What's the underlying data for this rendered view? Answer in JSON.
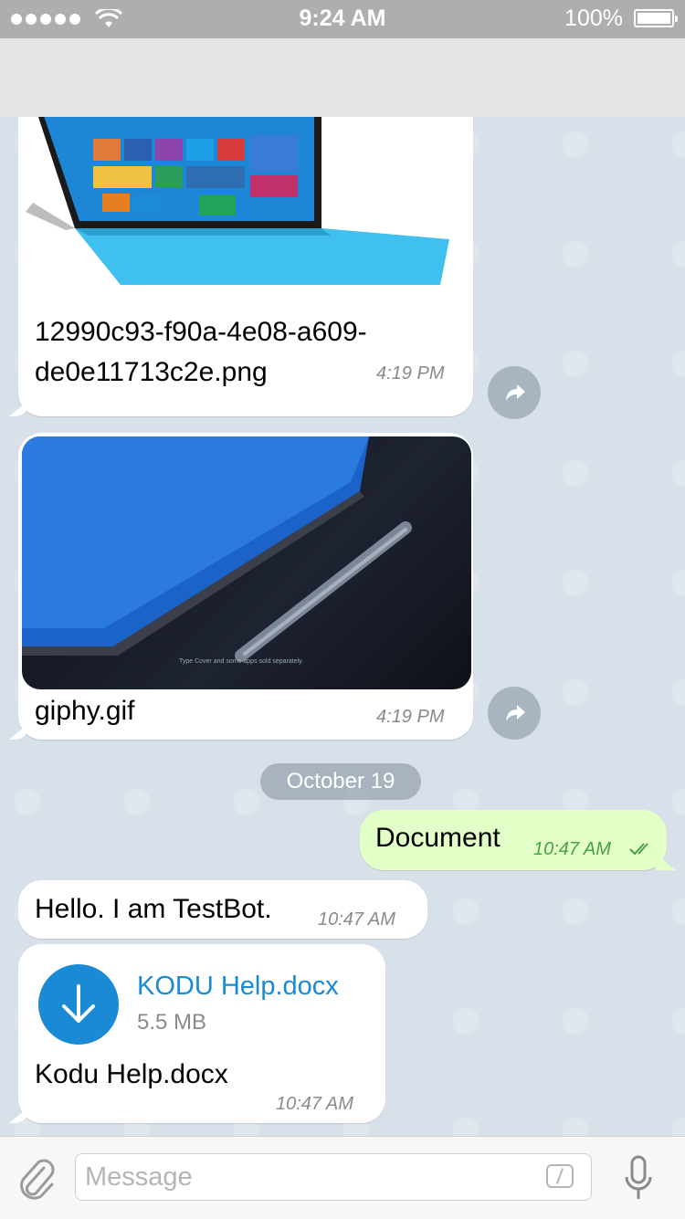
{
  "status_bar": {
    "time": "9:24 AM",
    "battery": "100%"
  },
  "messages": {
    "file1": {
      "name": "12990c93-f90a-4e08-a609-de0e11713c2e.png",
      "line1": "12990c93-f90a-4e08-a609-",
      "line2": "de0e11713c2e.png",
      "time": "4:19 PM"
    },
    "file2": {
      "name": "giphy.gif",
      "time": "4:19 PM",
      "caption": "Type Cover and some apps sold separately."
    },
    "date_separator": "October 19",
    "outgoing": {
      "text": "Document",
      "time": "10:47 AM"
    },
    "bot_greeting": {
      "text": "Hello. I am TestBot.",
      "time": "10:47 AM"
    },
    "document": {
      "title": "KODU Help.docx",
      "size": "5.5 MB",
      "caption": "Kodu Help.docx",
      "time": "10:47 AM"
    }
  },
  "input": {
    "placeholder": "Message"
  },
  "colors": {
    "accent": "#1a8ad4",
    "outgoing_bubble": "#e1ffc7",
    "read_check": "#4aa043"
  },
  "icons": [
    "wifi-icon",
    "battery-icon",
    "share-icon",
    "download-icon",
    "attach-icon",
    "bot-command-icon",
    "mic-icon",
    "double-check-icon"
  ]
}
